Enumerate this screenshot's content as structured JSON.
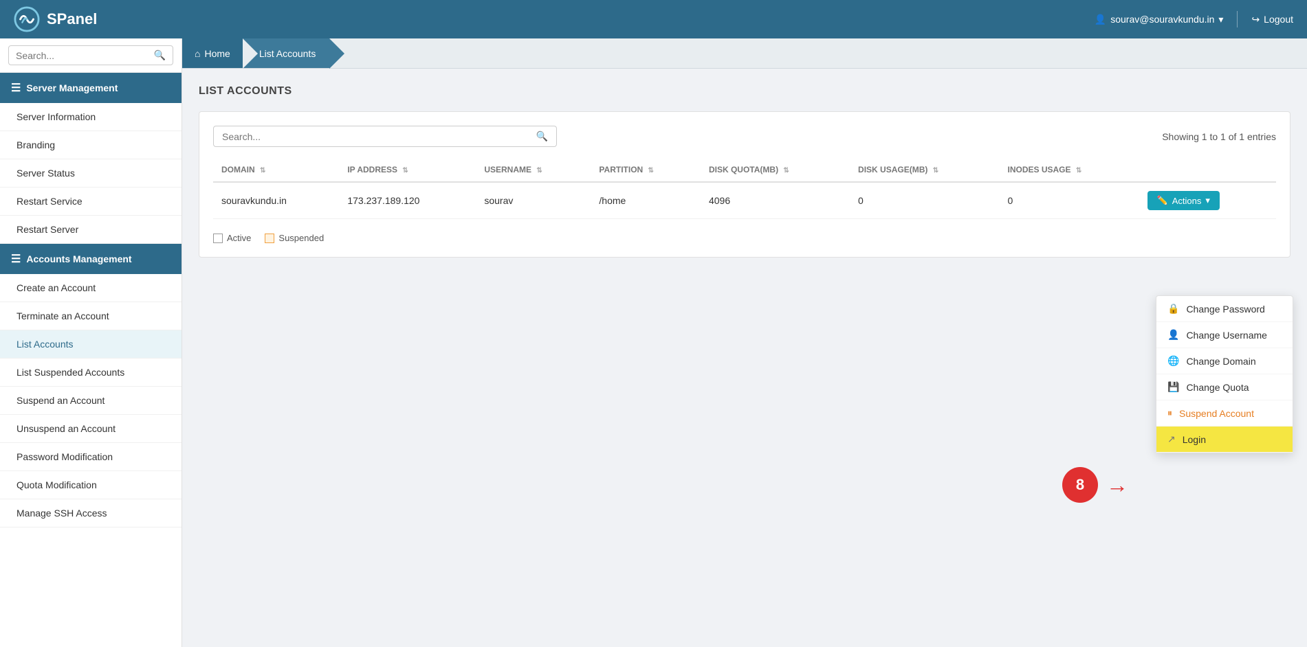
{
  "header": {
    "logo_text": "SPanel",
    "user_email": "sourav@souravkundu.in",
    "logout_label": "Logout"
  },
  "sidebar": {
    "search_placeholder": "Search...",
    "server_management_label": "Server Management",
    "accounts_management_label": "Accounts Management",
    "server_items": [
      {
        "label": "Server Information"
      },
      {
        "label": "Branding"
      },
      {
        "label": "Server Status"
      },
      {
        "label": "Restart Service"
      },
      {
        "label": "Restart Server"
      }
    ],
    "account_items": [
      {
        "label": "Create an Account"
      },
      {
        "label": "Terminate an Account"
      },
      {
        "label": "List Accounts",
        "active": true
      },
      {
        "label": "List Suspended Accounts"
      },
      {
        "label": "Suspend an Account"
      },
      {
        "label": "Unsuspend an Account"
      },
      {
        "label": "Password Modification"
      },
      {
        "label": "Quota Modification"
      },
      {
        "label": "Manage SSH Access"
      }
    ]
  },
  "breadcrumb": {
    "home_label": "Home",
    "current_label": "List Accounts"
  },
  "page": {
    "title": "LIST ACCOUNTS",
    "search_placeholder": "Search...",
    "entries_info": "Showing 1 to 1 of 1 entries",
    "table": {
      "columns": [
        {
          "label": "DOMAIN"
        },
        {
          "label": "IP ADDRESS"
        },
        {
          "label": "USERNAME"
        },
        {
          "label": "PARTITION"
        },
        {
          "label": "DISK QUOTA(MB)"
        },
        {
          "label": "DISK USAGE(MB)"
        },
        {
          "label": "INODES USAGE"
        }
      ],
      "rows": [
        {
          "domain": "souravkundu.in",
          "ip_address": "173.237.189.120",
          "username": "sourav",
          "partition": "/home",
          "disk_quota": "4096",
          "disk_usage": "0",
          "inodes_usage": "0"
        }
      ]
    },
    "actions_label": "Actions",
    "legend": {
      "active_label": "Active",
      "suspended_label": "Suspended"
    }
  },
  "dropdown": {
    "items": [
      {
        "label": "Change Password",
        "icon": "🔒",
        "type": "normal"
      },
      {
        "label": "Change Username",
        "icon": "👤",
        "type": "normal"
      },
      {
        "label": "Change Domain",
        "icon": "🌐",
        "type": "normal"
      },
      {
        "label": "Change Quota",
        "icon": "💾",
        "type": "normal"
      },
      {
        "label": "Suspend Account",
        "icon": "⏸",
        "type": "suspend"
      },
      {
        "label": "Login",
        "icon": "↗",
        "type": "login"
      }
    ]
  },
  "annotation": {
    "number": "8"
  }
}
